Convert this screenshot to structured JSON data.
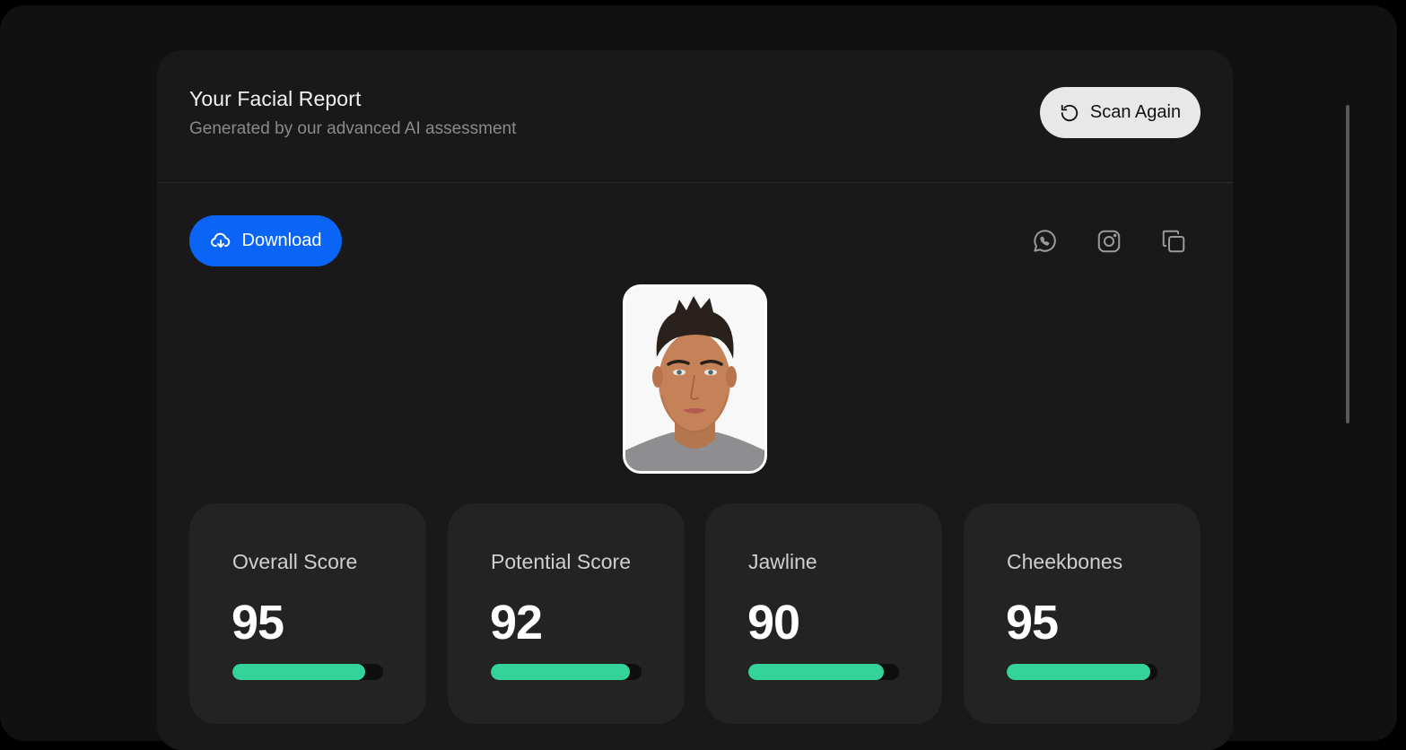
{
  "header": {
    "title": "Your Facial Report",
    "subtitle": "Generated by our advanced AI assessment",
    "scan_again_label": "Scan Again",
    "scan_again_icon": "rotate-ccw-icon"
  },
  "actions": {
    "download_label": "Download",
    "download_icon": "cloud-download-icon",
    "share_icons": [
      "whatsapp-icon",
      "instagram-icon",
      "copy-icon"
    ]
  },
  "colors": {
    "accent_blue": "#0a64f5",
    "progress_green": "#34d399",
    "card_bg": "#191919",
    "metric_bg": "#232323"
  },
  "metrics": [
    {
      "label": "Overall Score",
      "value": "95",
      "progress": 0.88
    },
    {
      "label": "Potential Score",
      "value": "92",
      "progress": 0.92
    },
    {
      "label": "Jawline",
      "value": "90",
      "progress": 0.9
    },
    {
      "label": "Cheekbones",
      "value": "95",
      "progress": 0.95
    }
  ]
}
